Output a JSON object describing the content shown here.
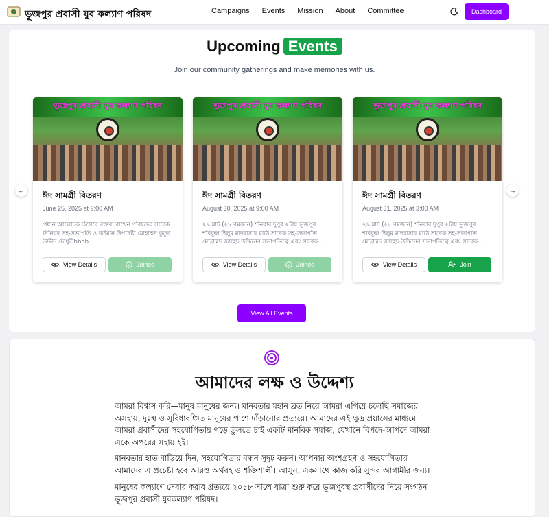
{
  "nav": {
    "brand": "ভূজপুর প্রবাসী যুব কল্যাণ পরিষদ",
    "links": [
      "Campaigns",
      "Events",
      "Mission",
      "About",
      "Committee"
    ],
    "dashboard": "Dashboard"
  },
  "events": {
    "title": "Upcoming",
    "title_highlight": "Events",
    "subtitle": "Join our community gatherings and make memories with us.",
    "cards": [
      {
        "banner": "ভূজপুর প্রবাসী যুব কল্যাণ পরিষদ",
        "title": "ঈদ সামগ্রী বিতরণ",
        "date": "June 25, 2025 at 9:00 AM",
        "desc": "প্রধান আলোচক হিসেবে বক্তব্য রাখেন পরিষদের সাবেক সিনিয়র সহ-সভাপতি ও বর্তমান উপদেষ্টা মোহাম্মদ কুতুব উদ্দীন চৌধুরীbbbb",
        "view": "View Details",
        "action": "Joined"
      },
      {
        "banner": "ভূজপুর প্রবাসী যুব কল্যাণ পরিষদ",
        "title": "ঈদ সামগ্রী বিতরণ",
        "date": "August 30, 2025 at 9:00 AM",
        "desc": "২৯ মার্চ (২৮ রমজান) শনিবার দুপুর ২টায় ভূজপুর শরিফুল উলুম মাদরাসার মাঠে সাবেক সহ-সভাপতি মোহাম্মদ জাহেদ উদ্দিনের সভাপতিত্বে এবং সাবেক...",
        "view": "View Details",
        "action": "Joined"
      },
      {
        "banner": "ভূজপুর প্রবাসী যুব কল্যাণ পরিষদ",
        "title": "ঈদ সামগ্রী বিতরণ",
        "date": "August 31, 2025 at 3:00 AM",
        "desc": "২৯ মার্চ (২৮ রমজান) শনিবার দুপুর ২টায় ভূজপুর শরিফুল উলুম মাদরাসার মাঠে সাবেক সহ-সভাপতি মোহাম্মদ জাহেদ উদ্দিনের সভাপতিত্বে এবং সাবেক...",
        "view": "View Details",
        "action": "Join"
      }
    ],
    "view_all": "View All Events"
  },
  "mission": {
    "title": "আমাদের লক্ষ ও উদ্দেশ্য",
    "p1": "আমরা বিশ্বাস করি—মানুষ মানুষের জন্য। মানবতার মহান ব্রত নিয়ে আমরা এগিয়ে চলেছি সমাজের অসহায়, দুঃস্থ ও সুবিধাবঞ্চিত মানুষের পাশে দাঁড়ানোর প্রত্যয়ে। আমাদের এই ক্ষুদ্র প্রয়াসের মাধ্যমে আমরা প্রবাসীদের সহযোগিতায় গড়ে তুলতে চাই একটি মানবিক সমাজ, যেখানে বিপদে-আপদে আমরা একে অপরের সহায় হই।",
    "p2": "মানবতার হাত বাড়িয়ে দিন, সহযোগিতার বন্ধন সুদৃঢ় করুন। আপনার অংশগ্রহণ ও সহযোগিতায় আমাদের এ প্রচেষ্টা হবে আরও অর্থবহ ও শক্তিশালী। আসুন, একসাথে কাজ করি সুন্দর আগামীর জন্য।",
    "p3": "মানুষের কল্যাণে সেবার করার প্রত্যয়ে ২০১৮ সালে যাত্রা শুরু করে ভূজপুরস্থ প্রবাসীদের নিয়ে সংগঠন ভূজপুর প্রবাসী যুবকল্যাণ পরিষদ।"
  }
}
